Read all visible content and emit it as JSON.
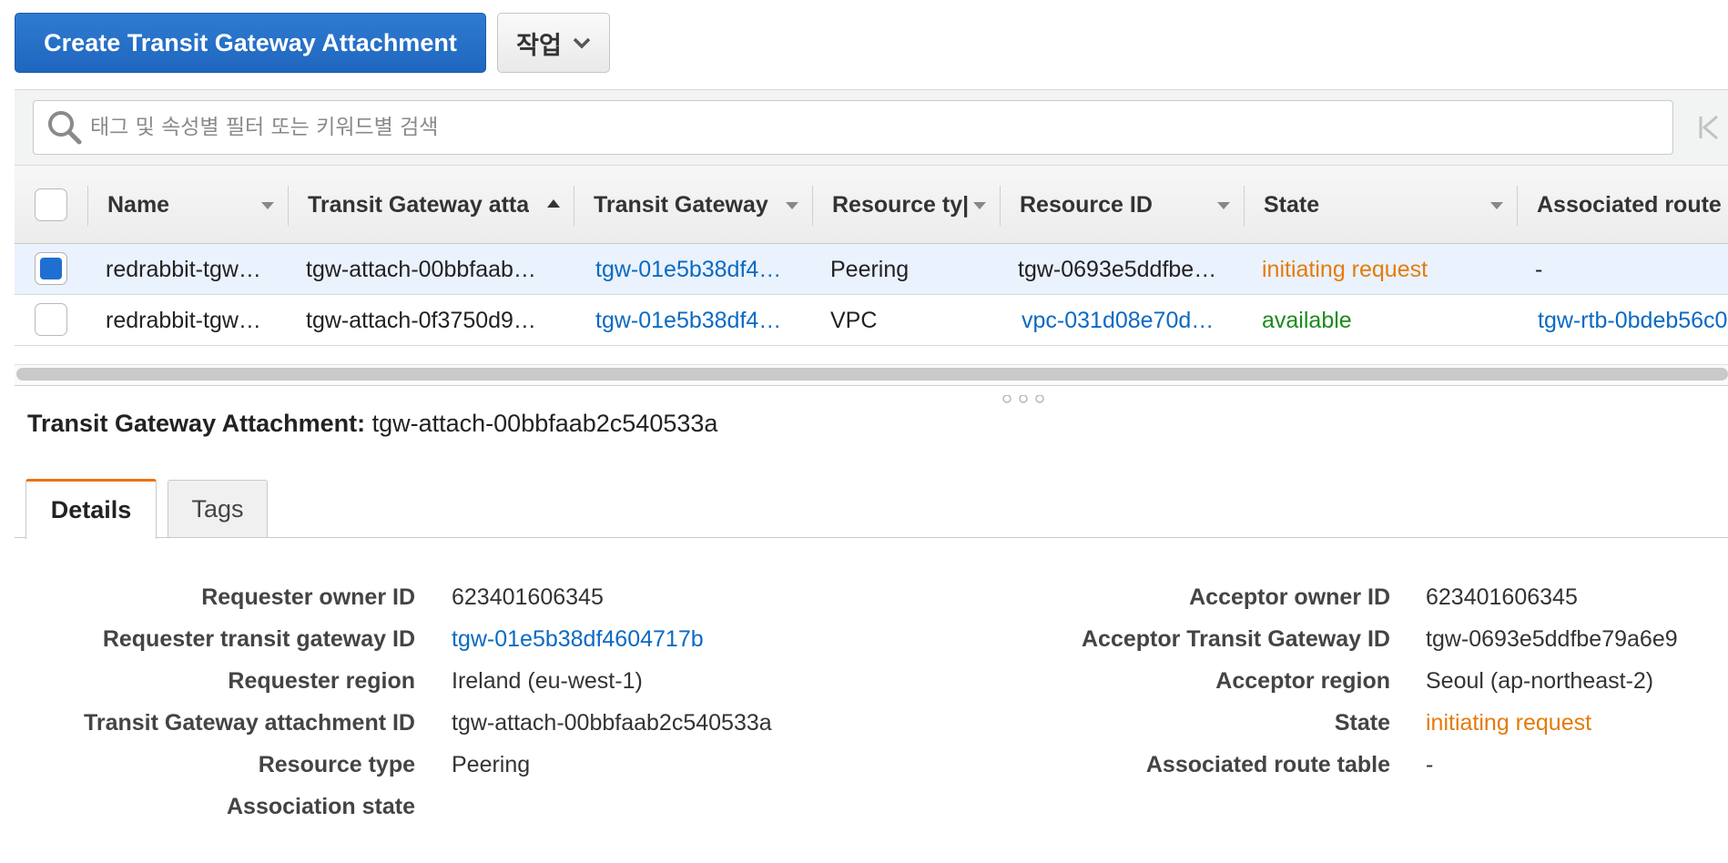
{
  "toolbar": {
    "create_label": "Create Transit Gateway Attachment",
    "actions_label": "작업"
  },
  "search": {
    "placeholder": "태그 및 속성별 필터 또는 키워드별 검색"
  },
  "table": {
    "columns": [
      {
        "label": "Name"
      },
      {
        "label": "Transit Gateway atta",
        "sorted": "ascending"
      },
      {
        "label": "Transit Gateway"
      },
      {
        "label": "Resource ty|"
      },
      {
        "label": "Resource ID"
      },
      {
        "label": "State"
      },
      {
        "label": "Associated route"
      }
    ],
    "rows": [
      {
        "selected": true,
        "name": "redrabbit-tgw…",
        "attachment_id": "tgw-attach-00bbfaab…",
        "transit_gateway": "tgw-01e5b38df4…",
        "resource_type": "Peering",
        "resource_id": "tgw-0693e5ddfbe…",
        "state": "initiating request",
        "associated_route": "-"
      },
      {
        "selected": false,
        "name": "redrabbit-tgw…",
        "attachment_id": "tgw-attach-0f3750d9…",
        "transit_gateway": "tgw-01e5b38df4…",
        "resource_type": "VPC",
        "resource_id": "vpc-031d08e70d…",
        "state": "available",
        "associated_route": "tgw-rtb-0bdeb56c0"
      }
    ]
  },
  "details": {
    "title_label": "Transit Gateway Attachment:",
    "title_value": "tgw-attach-00bbfaab2c540533a",
    "tabs": [
      {
        "label": "Details",
        "active": true
      },
      {
        "label": "Tags",
        "active": false
      }
    ],
    "left": [
      {
        "label": "Requester owner ID",
        "value": "623401606345"
      },
      {
        "label": "Requester transit gateway ID",
        "value": "tgw-01e5b38df4604717b",
        "link": true
      },
      {
        "label": "Requester region",
        "value": "Ireland (eu-west-1)"
      },
      {
        "label": "Transit Gateway attachment ID",
        "value": "tgw-attach-00bbfaab2c540533a"
      },
      {
        "label": "Resource type",
        "value": "Peering"
      },
      {
        "label": "Association state",
        "value": ""
      }
    ],
    "right": [
      {
        "label": "Acceptor owner ID",
        "value": "623401606345"
      },
      {
        "label": "Acceptor Transit Gateway ID",
        "value": "tgw-0693e5ddfbe79a6e9"
      },
      {
        "label": "Acceptor region",
        "value": "Seoul (ap-northeast-2)"
      },
      {
        "label": "State",
        "value": "initiating request",
        "status": "orange"
      },
      {
        "label": "Associated route table",
        "value": "-"
      }
    ]
  },
  "colors": {
    "primary": "#1f66bf",
    "link": "#0b6ac2",
    "pending": "#e57b0a",
    "available": "#1d8a1d",
    "tab_accent": "#ec7211",
    "selected_row": "#eaf2fd"
  },
  "icons": [
    "search-icon",
    "chevron-down-icon",
    "sort-ascending-icon",
    "first-page-icon",
    "resize-handle-icon"
  ]
}
